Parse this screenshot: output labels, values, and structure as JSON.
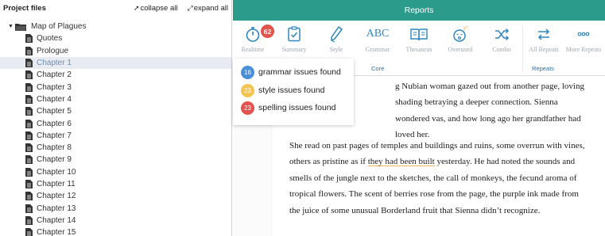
{
  "sidebar": {
    "title": "Project files",
    "collapse_label": "collapse all",
    "expand_label": "expand all",
    "root_label": "Map of Plagues",
    "items": [
      "Quotes",
      "Prologue",
      "Chapter 1",
      "Chapter 2",
      "Chapter 3",
      "Chapter 4",
      "Chapter 5",
      "Chapter 6",
      "Chapter 7",
      "Chapter 8",
      "Chapter 9",
      "Chapter 10",
      "Chapter 11",
      "Chapter 12",
      "Chapter 13",
      "Chapter 14",
      "Chapter 15"
    ],
    "selected": "Chapter 1"
  },
  "header": {
    "title": "Reports"
  },
  "toolbar": {
    "realtime": "Realtime",
    "realtime_count": "62",
    "summary": "Summary",
    "style": "Style",
    "grammar": "Grammar",
    "thesaurus": "Thesaurus",
    "overused": "Overused",
    "combo": "Combo",
    "all_repeats": "All Repeats",
    "more_repeats": "More Repeats",
    "core_group": "Core",
    "repeats_group": "Repeats",
    "grammar_glyph": "ABC"
  },
  "popup": {
    "grammar": {
      "count": "16",
      "label": "grammar issues found",
      "color": "#4a90d9"
    },
    "style": {
      "count": "23",
      "label": "style issues found",
      "color": "#f5c451"
    },
    "spelling": {
      "count": "23",
      "label": "spelling issues found",
      "color": "#e2534d"
    }
  },
  "document": {
    "para1": "g Nubian woman gazed out from another page, loving shading betraying a deeper connection. Sienna wondered vas, and how long ago her grandfather had loved her.",
    "para2_a": "She read on past pages of temples and buildings and ruins, some overrun with vines, others as pristine as if ",
    "para2_underlined": "they had been built",
    "para2_b": " yesterday. He had noted the sounds and smells of the jungle next to the sketches, the call of monkeys, the fecund aroma of tropical flowers. The scent of berries rose from the page, the purple ink made from the juice of some unusual Borderland fruit that Sienna didn’t recognize."
  },
  "colors": {
    "header_bg": "#2b9c8c",
    "icon": "#2e86c1",
    "accent_label": "#1f6fb2"
  }
}
